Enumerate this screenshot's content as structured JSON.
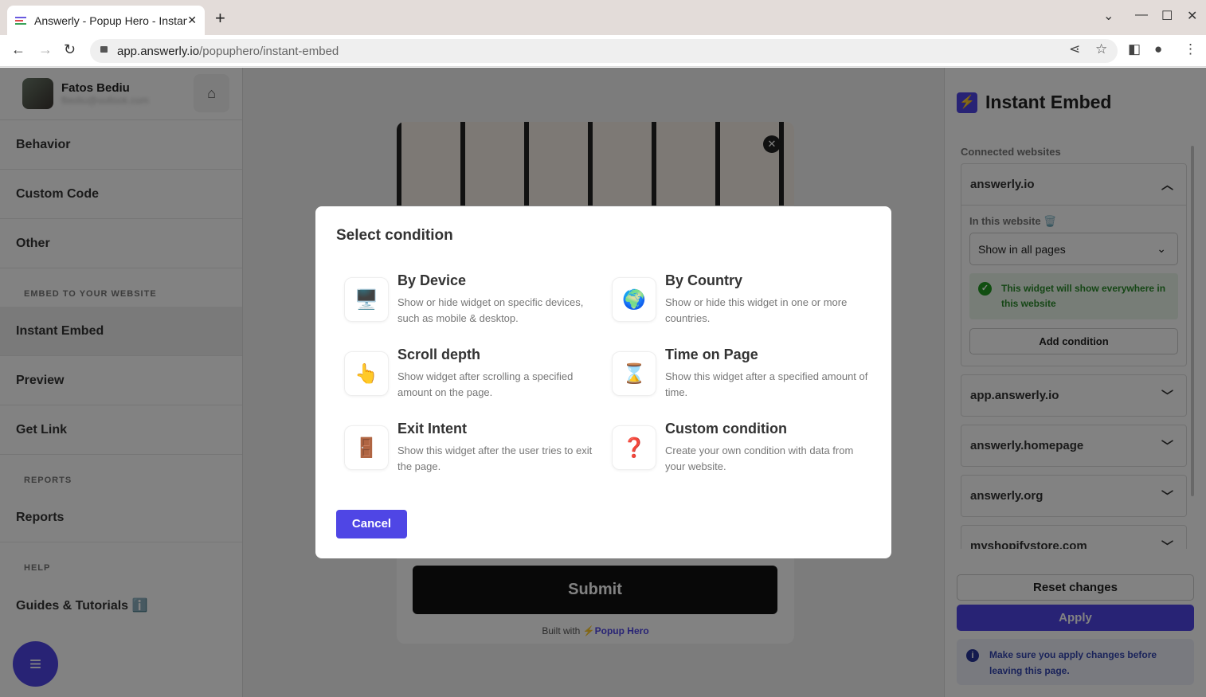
{
  "browser": {
    "tab_title": "Answerly - Popup Hero - Instant Embed",
    "url_host": "app.answerly.io",
    "url_path": "/popuphero/instant-embed"
  },
  "sidebar": {
    "user_name": "Fatos Bediu",
    "user_email": "fbediu@outlook.com",
    "items": [
      {
        "label": "Behavior"
      },
      {
        "label": "Custom Code"
      },
      {
        "label": "Other"
      }
    ],
    "embed_header": "EMBED TO YOUR WEBSITE",
    "embed_items": [
      {
        "label": "Instant Embed"
      },
      {
        "label": "Preview"
      },
      {
        "label": "Get Link"
      }
    ],
    "reports_header": "REPORTS",
    "reports_item": "Reports",
    "help_header": "HELP",
    "help_item": "Guides & Tutorials ℹ️"
  },
  "preview": {
    "submit_label": "Submit",
    "built_with": "Built with",
    "brand": "⚡Popup Hero"
  },
  "right_panel": {
    "title": "Instant Embed",
    "connected_label": "Connected websites",
    "sites": [
      {
        "name": "answerly.io",
        "expanded": true
      },
      {
        "name": "app.answerly.io"
      },
      {
        "name": "answerly.homepage"
      },
      {
        "name": "answerly.org"
      },
      {
        "name": "myshopifystore.com"
      }
    ],
    "in_this_website": "In this website 🗑️",
    "page_select": "Show in all pages",
    "success_msg": "This widget will show everywhere in this website",
    "add_condition": "Add condition",
    "reset_label": "Reset changes",
    "apply_label": "Apply",
    "info_msg": "Make sure you apply changes before leaving this page."
  },
  "modal": {
    "title": "Select condition",
    "cancel_label": "Cancel",
    "options": [
      {
        "title": "By Device",
        "desc": "Show or hide widget on specific devices, such as mobile & desktop.",
        "icon": "🖥️"
      },
      {
        "title": "By Country",
        "desc": "Show or hide this widget in one or more countries.",
        "icon": "🌍"
      },
      {
        "title": "Scroll depth",
        "desc": "Show widget after scrolling a specified amount on the page.",
        "icon": "👆"
      },
      {
        "title": "Time on Page",
        "desc": "Show this widget after a specified amount of time.",
        "icon": "⌛"
      },
      {
        "title": "Exit Intent",
        "desc": "Show this widget after the user tries to exit the page.",
        "icon": "🚪"
      },
      {
        "title": "Custom condition",
        "desc": "Create your own condition with data from your website.",
        "icon": "❓"
      }
    ]
  },
  "colors": {
    "accent": "#4f46e5",
    "success": "#2a8a2a"
  }
}
